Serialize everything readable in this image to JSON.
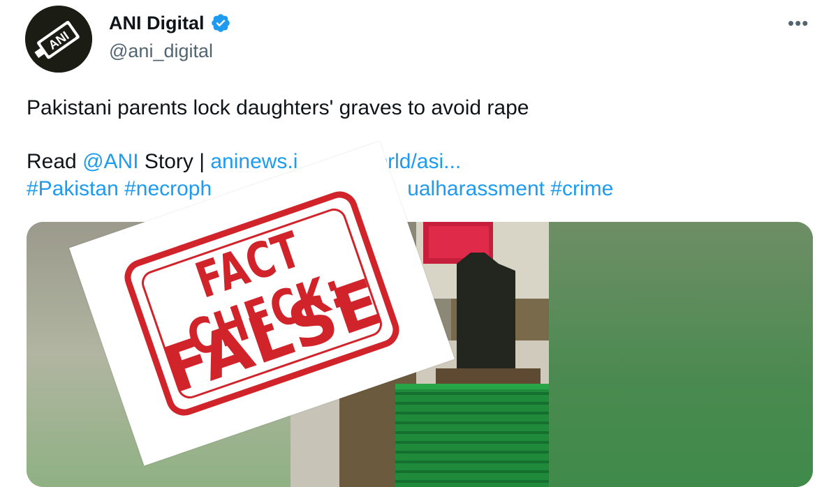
{
  "tweet": {
    "display_name": "ANI Digital",
    "handle": "@ani_digital",
    "more_label": "•••",
    "text": "Pakistani parents lock daughters' graves to avoid rape",
    "read_prefix": "Read ",
    "mention": "@ANI",
    "read_mid": " Story | ",
    "link_text": "aninews.i",
    "link_tail": "vs/world/asi...",
    "hashtags_left": "#Pakistan #necroph",
    "hashtags_right": "ualharassment #crime"
  },
  "avatar": {
    "logo_text": "ANI"
  },
  "stamp": {
    "top_text": "FACT CHECK:",
    "bottom_text": "FALSE"
  },
  "colors": {
    "link": "#1d9bf0",
    "stamp_red": "#d0232a",
    "verified": "#1d9bf0"
  }
}
